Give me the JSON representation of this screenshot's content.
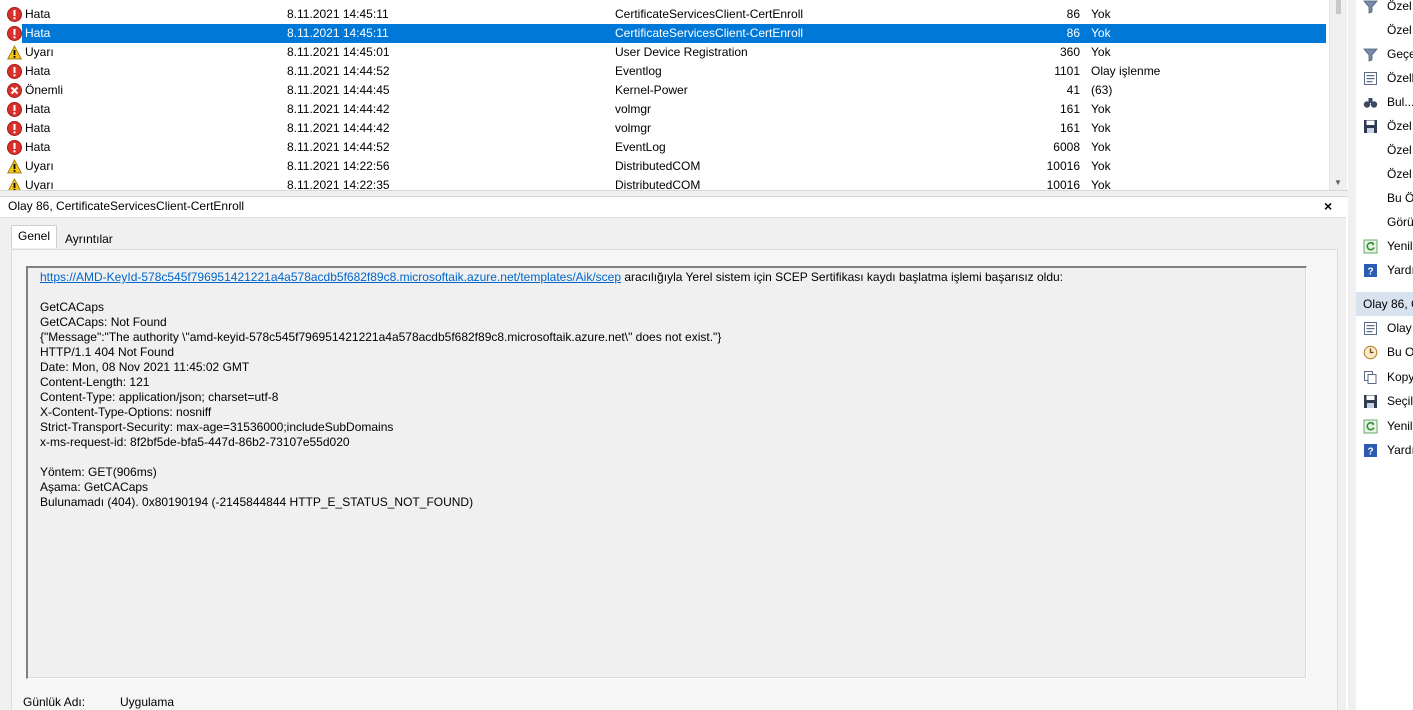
{
  "events": [
    {
      "level": "Hata",
      "level_type": "error",
      "date": "8.11.2021 14:45:11",
      "source": "CertificateServicesClient-CertEnroll",
      "id": "86",
      "task": "Yok",
      "selected": false
    },
    {
      "level": "Hata",
      "level_type": "error",
      "date": "8.11.2021 14:45:11",
      "source": "CertificateServicesClient-CertEnroll",
      "id": "86",
      "task": "Yok",
      "selected": true
    },
    {
      "level": "Uyarı",
      "level_type": "warning",
      "date": "8.11.2021 14:45:01",
      "source": "User Device Registration",
      "id": "360",
      "task": "Yok",
      "selected": false
    },
    {
      "level": "Hata",
      "level_type": "error",
      "date": "8.11.2021 14:44:52",
      "source": "Eventlog",
      "id": "1101",
      "task": "Olay işlenme",
      "selected": false
    },
    {
      "level": "Önemli",
      "level_type": "critical",
      "date": "8.11.2021 14:44:45",
      "source": "Kernel-Power",
      "id": "41",
      "task": "(63)",
      "selected": false
    },
    {
      "level": "Hata",
      "level_type": "error",
      "date": "8.11.2021 14:44:42",
      "source": "volmgr",
      "id": "161",
      "task": "Yok",
      "selected": false
    },
    {
      "level": "Hata",
      "level_type": "error",
      "date": "8.11.2021 14:44:42",
      "source": "volmgr",
      "id": "161",
      "task": "Yok",
      "selected": false
    },
    {
      "level": "Hata",
      "level_type": "error",
      "date": "8.11.2021 14:44:52",
      "source": "EventLog",
      "id": "6008",
      "task": "Yok",
      "selected": false
    },
    {
      "level": "Uyarı",
      "level_type": "warning",
      "date": "8.11.2021 14:22:56",
      "source": "DistributedCOM",
      "id": "10016",
      "task": "Yok",
      "selected": false
    },
    {
      "level": "Uyarı",
      "level_type": "warning",
      "date": "8.11.2021 14:22:35",
      "source": "DistributedCOM",
      "id": "10016",
      "task": "Yok",
      "selected": false
    }
  ],
  "detail": {
    "title": "Olay 86, CertificateServicesClient-CertEnroll",
    "close_glyph": "×",
    "tabs": [
      "Genel",
      "Ayrıntılar"
    ],
    "message_link": "https://AMD-KeyId-578c545f796951421221a4a578acdb5f682f89c8.microsoftaik.azure.net/templates/Aik/scep",
    "message_first_line_rest": " aracılığıyla Yerel sistem için SCEP Sertifikası kaydı başlatma işlemi başarısız oldu:",
    "message_lines": [
      "GetCACaps",
      "GetCACaps: Not Found",
      "{\"Message\":\"The authority \\\"amd-keyid-578c545f796951421221a4a578acdb5f682f89c8.microsoftaik.azure.net\\\" does not exist.\"}",
      "HTTP/1.1 404 Not Found",
      "Date: Mon, 08 Nov 2021 11:45:02 GMT",
      "Content-Length: 121",
      "Content-Type: application/json; charset=utf-8",
      "X-Content-Type-Options: nosniff",
      "Strict-Transport-Security: max-age=31536000;includeSubDomains",
      "x-ms-request-id: 8f2bf5de-bfa5-447d-86b2-73107e55d020",
      "",
      "Yöntem: GET(906ms)",
      "Aşama: GetCACaps",
      "Bulunamadı (404). 0x80190194 (-2145844844 HTTP_E_STATUS_NOT_FOUND)"
    ],
    "log_name_label": "Günlük Adı:",
    "log_name_value": "Uygulama"
  },
  "actions": {
    "top": [
      {
        "label": "Özel",
        "icon": "filter-icon"
      },
      {
        "label": "Özel",
        "icon": ""
      },
      {
        "label": "Geçe",
        "icon": "filter-icon"
      },
      {
        "label": "Özell",
        "icon": "properties-icon"
      },
      {
        "label": "Bul...",
        "icon": "binoculars-icon"
      },
      {
        "label": "Özel",
        "icon": "save-icon"
      },
      {
        "label": "Özel",
        "icon": ""
      },
      {
        "label": "Özel",
        "icon": ""
      },
      {
        "label": "Bu Ö",
        "icon": ""
      },
      {
        "label": "Görü",
        "icon": ""
      },
      {
        "label": "Yenil",
        "icon": "refresh-icon"
      },
      {
        "label": "Yardı",
        "icon": "help-icon"
      }
    ],
    "section_title": "Olay 86, C",
    "bottom": [
      {
        "label": "Olay",
        "icon": "properties-icon"
      },
      {
        "label": "Bu O",
        "icon": "task-icon"
      },
      {
        "label": "Kopy",
        "icon": "copy-icon"
      },
      {
        "label": "Seçil",
        "icon": "save-icon"
      },
      {
        "label": "Yenil",
        "icon": "refresh-icon"
      },
      {
        "label": "Yardı",
        "icon": "help-icon"
      }
    ]
  }
}
